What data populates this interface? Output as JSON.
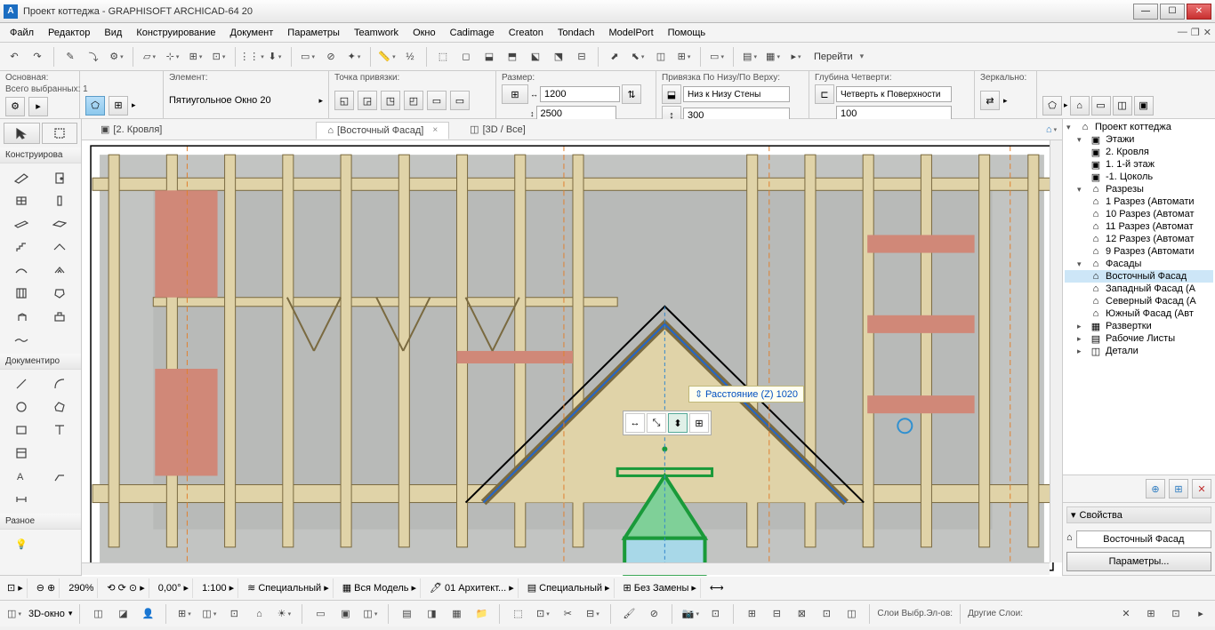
{
  "title": "Проект коттеджа - GRAPHISOFT ARCHICAD-64 20",
  "menu": [
    "Файл",
    "Редактор",
    "Вид",
    "Конструирование",
    "Документ",
    "Параметры",
    "Teamwork",
    "Окно",
    "Cadimage",
    "Creaton",
    "Tondach",
    "ModelPort",
    "Помощь"
  ],
  "info": {
    "main_label": "Основная:",
    "selected_label": "Всего выбранных: 1",
    "element_label": "Элемент:",
    "element_value": "Пятиугольное Окно 20",
    "anchor_label": "Точка привязки:",
    "size_label": "Размер:",
    "size_w": "1200",
    "size_h": "2500",
    "bind_label": "Привязка По Низу/По Верху:",
    "bind_value": "Низ к Низу Стены",
    "bind_num": "300",
    "reveal_label": "Глубина Четверти:",
    "reveal_value": "Четверть к Поверхности",
    "reveal_num": "100",
    "mirror_label": "Зеркально:"
  },
  "tabs": [
    {
      "label": "[2. Кровля]",
      "active": false
    },
    {
      "label": "[Восточный Фасад]",
      "active": true
    },
    {
      "label": "[3D / Все]",
      "active": false
    }
  ],
  "toolbox": {
    "arrow_header": "",
    "design_header": "Конструирова",
    "doc_header": "Документиро",
    "misc_header": "Разное"
  },
  "goto": "Перейти",
  "hint": "Расстояние (Z)  1020",
  "navigator": {
    "root": "Проект коттеджа",
    "stories_label": "Этажи",
    "stories": [
      "2. Кровля",
      "1. 1-й этаж",
      "-1. Цоколь"
    ],
    "sections_label": "Разрезы",
    "sections": [
      "1 Разрез (Автомати",
      "10 Разрез (Автомат",
      "11 Разрез (Автомат",
      "12 Разрез (Автомат",
      "9 Разрез (Автомати"
    ],
    "elev_label": "Фасады",
    "elevations": [
      "Восточный Фасад",
      "Западный Фасад (А",
      "Северный Фасад (А",
      "Южный Фасад (Авт"
    ],
    "int_label": "Развертки",
    "ws_label": "Рабочие Листы",
    "det_label": "Детали",
    "props_label": "Свойства",
    "prop_value": "Восточный Фасад",
    "prop_btn": "Параметры..."
  },
  "status": {
    "zoom": "290%",
    "angle": "0,00°",
    "scale": "1:100",
    "s1": "Специальный",
    "s2": "Вся Модель",
    "s3": "01 Архитект...",
    "s4": "Специальный",
    "s5": "Без Замены"
  },
  "bottom": {
    "view": "3D-окно",
    "layers1": "Слои Выбр.Эл-ов:",
    "layers2": "Другие Слои:"
  }
}
